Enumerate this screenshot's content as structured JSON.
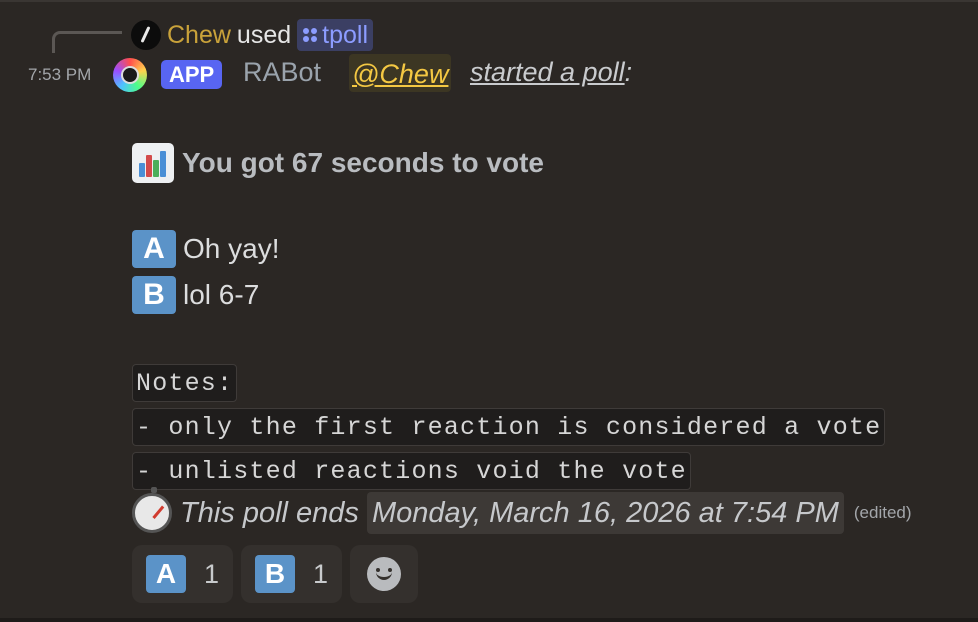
{
  "reply": {
    "user": "Chew",
    "used_text": "used",
    "command": "tpoll"
  },
  "message": {
    "timestamp": "7:53 PM",
    "app_badge": "APP",
    "bot_name": "RABot",
    "mention": "@Chew",
    "action_text": "started a poll",
    "action_suffix": ":"
  },
  "poll": {
    "title": "You got 67 seconds to vote",
    "options": [
      {
        "letter": "A",
        "text": "Oh yay!"
      },
      {
        "letter": "B",
        "text": "lol 6-7"
      }
    ],
    "notes": [
      "Notes:",
      "- only the first reaction is considered a vote",
      "- unlisted reactions void the vote"
    ],
    "ends_prefix": "This poll ends",
    "ends_date": "Monday, March 16, 2026 at 7:54 PM",
    "edited": "(edited)"
  },
  "reactions": [
    {
      "letter": "A",
      "count": "1"
    },
    {
      "letter": "B",
      "count": "1"
    }
  ],
  "icons": {
    "reply_avatar": "slash-avatar-icon",
    "command": "slash-command-icon",
    "bot_avatar": "bot-avatar-icon",
    "chart": "bar-chart-icon",
    "timer": "stopwatch-icon",
    "add_reaction": "add-reaction-icon"
  },
  "colors": {
    "background": "#2b2724",
    "app_badge": "#5865f2",
    "mention": "#f4c843",
    "letter_box": "#5b93c8",
    "command": "#8c9cff"
  }
}
